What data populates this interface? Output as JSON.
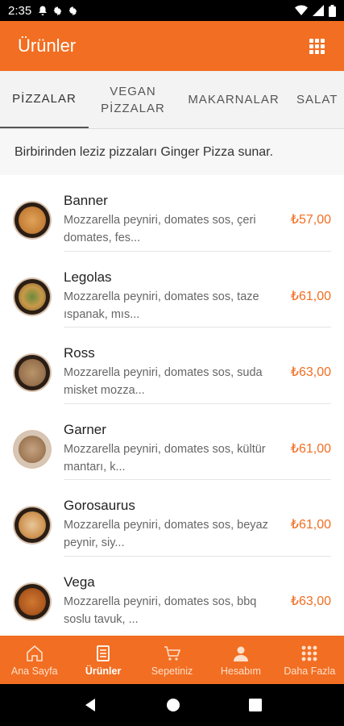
{
  "status": {
    "time": "2:35",
    "left_icons": [
      "notification-bell-icon",
      "settings-gear-icon",
      "settings-gear-icon"
    ],
    "right_icons": [
      "wifi-icon",
      "signal-icon",
      "battery-icon"
    ]
  },
  "appbar": {
    "title": "Ürünler",
    "menu_icon": "grid-icon"
  },
  "tabs": [
    {
      "label": "PİZZALAR",
      "active": true
    },
    {
      "label": "VEGAN\nPİZZALAR",
      "active": false
    },
    {
      "label": "MAKARNALAR",
      "active": false
    },
    {
      "label": "SALAT",
      "active": false
    }
  ],
  "category_description": "Birbirinden leziz pizzaları Ginger Pizza sunar.",
  "products": [
    {
      "name": "Banner",
      "description_line1": "Mozzarella peyniri, domates sos, çeri",
      "description_line2": "domates, fes...",
      "price": "₺57,00"
    },
    {
      "name": "Legolas",
      "description_line1": "Mozzarella peyniri, domates sos, taze",
      "description_line2": "ıspanak, mıs...",
      "price": "₺61,00"
    },
    {
      "name": "Ross",
      "description_line1": "Mozzarella peyniri, domates sos, suda",
      "description_line2": "misket mozza...",
      "price": "₺63,00"
    },
    {
      "name": "Garner",
      "description_line1": "Mozzarella peyniri, domates sos, kültür",
      "description_line2": "mantarı, k...",
      "price": "₺61,00"
    },
    {
      "name": "Gorosaurus",
      "description_line1": "Mozzarella peyniri, domates sos, beyaz",
      "description_line2": "peynir, siy...",
      "price": "₺61,00"
    },
    {
      "name": "Vega",
      "description_line1": "Mozzarella peyniri, domates sos, bbq",
      "description_line2": "soslu tavuk, ...",
      "price": "₺63,00"
    }
  ],
  "bottom_nav": [
    {
      "label": "Ana Sayfa",
      "icon": "home-icon",
      "active": false
    },
    {
      "label": "Ürünler",
      "icon": "menu-list-icon",
      "active": true
    },
    {
      "label": "Sepetiniz",
      "icon": "cart-icon",
      "active": false
    },
    {
      "label": "Hesabım",
      "icon": "user-icon",
      "active": false
    },
    {
      "label": "Daha Fazla",
      "icon": "grid-icon",
      "active": false
    }
  ],
  "system_nav": [
    "back-icon",
    "home-circle-icon",
    "recents-icon"
  ],
  "colors": {
    "accent": "#f26e22",
    "price": "#f26e22"
  }
}
